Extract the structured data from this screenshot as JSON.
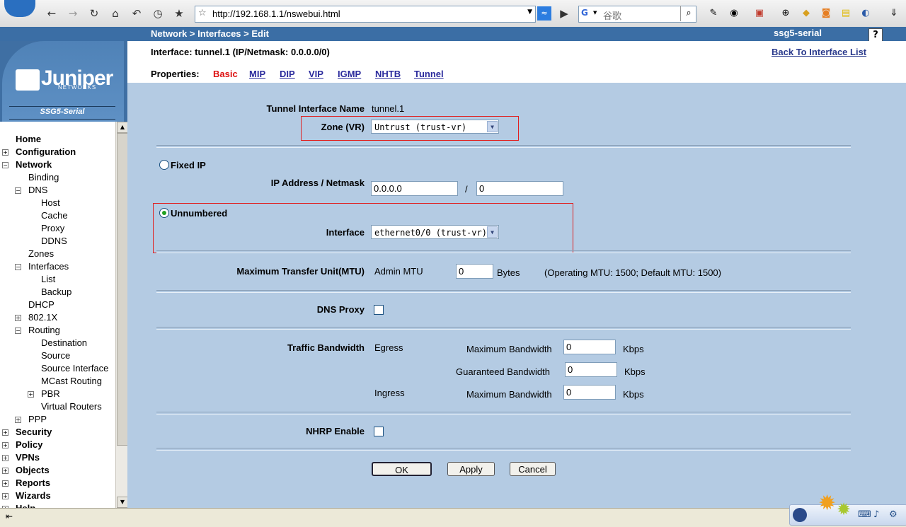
{
  "browser": {
    "url": "http://192.168.1.1/nswebui.html",
    "search_placeholder": "谷歌"
  },
  "header": {
    "breadcrumb": "Network > Interfaces > Edit",
    "hostname": "ssg5-serial",
    "help_label": "?"
  },
  "sidebar": {
    "logo": "Juniper",
    "logo_sub": "NETWORKS",
    "model": "SSG5-Serial",
    "items": [
      {
        "label": "Home"
      },
      {
        "label": "Configuration"
      },
      {
        "label": "Network"
      },
      {
        "label": "Binding"
      },
      {
        "label": "DNS"
      },
      {
        "label": "Host"
      },
      {
        "label": "Cache"
      },
      {
        "label": "Proxy"
      },
      {
        "label": "DDNS"
      },
      {
        "label": "Zones"
      },
      {
        "label": "Interfaces"
      },
      {
        "label": "List"
      },
      {
        "label": "Backup"
      },
      {
        "label": "DHCP"
      },
      {
        "label": "802.1X"
      },
      {
        "label": "Routing"
      },
      {
        "label": "Destination"
      },
      {
        "label": "Source"
      },
      {
        "label": "Source Interface"
      },
      {
        "label": "MCast Routing"
      },
      {
        "label": "PBR"
      },
      {
        "label": "Virtual Routers"
      },
      {
        "label": "PPP"
      },
      {
        "label": "Security"
      },
      {
        "label": "Policy"
      },
      {
        "label": "VPNs"
      },
      {
        "label": "Objects"
      },
      {
        "label": "Reports"
      },
      {
        "label": "Wizards"
      },
      {
        "label": "Help"
      }
    ]
  },
  "page": {
    "title": "Interface: tunnel.1 (IP/Netmask: 0.0.0.0/0)",
    "back_link": "Back To Interface List",
    "properties_label": "Properties:",
    "tabs": [
      "Basic",
      "MIP",
      "DIP",
      "VIP",
      "IGMP",
      "NHTB",
      "Tunnel"
    ],
    "active_tab": "Basic"
  },
  "form": {
    "tunnel_name_label": "Tunnel Interface Name",
    "tunnel_name_value": "tunnel.1",
    "zone_label": "Zone (VR)",
    "zone_value": "Untrust (trust-vr)",
    "fixed_ip_label": "Fixed IP",
    "ip_netmask_label": "IP Address / Netmask",
    "ip_value": "0.0.0.0",
    "slash": "/",
    "netmask_value": "0",
    "unnumbered_label": "Unnumbered",
    "interface_label": "Interface",
    "interface_value": "ethernet0/0 (trust-vr)",
    "mtu_label": "Maximum Transfer Unit(MTU)",
    "admin_mtu_label": "Admin MTU",
    "admin_mtu_value": "0",
    "bytes_label": "Bytes",
    "mtu_note": "(Operating MTU: 1500; Default MTU: 1500)",
    "dns_proxy_label": "DNS Proxy",
    "traffic_label": "Traffic Bandwidth",
    "egress_label": "Egress",
    "ingress_label": "Ingress",
    "max_bw_label": "Maximum Bandwidth",
    "guar_bw_label": "Guaranteed Bandwidth",
    "egress_max_value": "0",
    "egress_guar_value": "0",
    "ingress_max_value": "0",
    "kbps": "Kbps",
    "nhrp_label": "NHRP Enable",
    "ok_label": "OK",
    "apply_label": "Apply",
    "cancel_label": "Cancel"
  }
}
